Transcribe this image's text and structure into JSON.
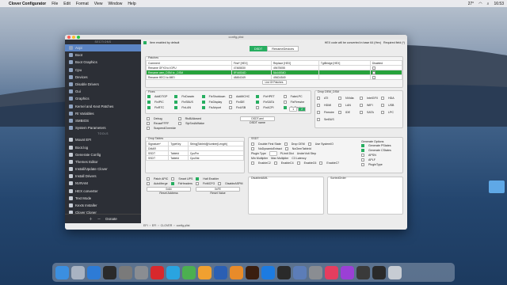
{
  "menubar": {
    "app": "Clover Configurator",
    "items": [
      "File",
      "Edit",
      "Format",
      "View",
      "Window",
      "Help"
    ],
    "status": "27°",
    "clock": "16:53"
  },
  "window": {
    "title": "config.plist",
    "item_enabled": "Item enabled by default",
    "hex_note": "HEX code will be converted in base 64 (Hex)",
    "required": "Required field (*)"
  },
  "sidebar": {
    "section_header": "SECTIONS",
    "tools_header": "TOOLS",
    "items": [
      "Acpi",
      "Boot",
      "Boot Graphics",
      "Cpu",
      "Devices",
      "Disable Drivers",
      "Gui",
      "Graphics",
      "Kernel and Kext Patches",
      "Rt Variables",
      "SMBIOS",
      "System Parameters"
    ],
    "tools": [
      "Mount EFI",
      "Boot.log",
      "Generate Config",
      "Themes Editor",
      "Install/Update Clover",
      "Install Drivers",
      "NVRAM",
      "HEX converter",
      "Text Mode",
      "Kexts Installer",
      "Clover Cloner"
    ],
    "donate": "Donate"
  },
  "tabs": [
    "DSDT",
    "RenameDevices"
  ],
  "patches": {
    "label": "Patches",
    "columns": [
      "Comment",
      "Find* [HEX]",
      "Replace [HEX]",
      "TgtBridge [HEX]",
      "Disabled"
    ],
    "rows": [
      [
        "Rename GFX0 to IGPU",
        "47465830",
        "49475055",
        "",
        ""
      ],
      [
        "Rename oem_DSM to _DSM",
        "5F44534D",
        "5A44534D",
        "",
        ""
      ],
      [
        "Rename HECI to IMEI",
        "48454349",
        "494D4549",
        "",
        ""
      ]
    ],
    "list_button": "List Of Patches"
  },
  "fixes": {
    "label": "Fixes",
    "items": [
      {
        "name": "AddDTGP",
        "on": true
      },
      {
        "name": "FixDarwin",
        "on": true
      },
      {
        "name": "FixShutdown",
        "on": true
      },
      {
        "name": "AddMCHC",
        "on": false
      },
      {
        "name": "FixHPET",
        "on": true
      },
      {
        "name": "FakeLPC",
        "on": false
      },
      {
        "name": "FixIPIC",
        "on": true
      },
      {
        "name": "FixSBUS",
        "on": true
      },
      {
        "name": "FixDisplay",
        "on": true
      },
      {
        "name": "FixIDE",
        "on": false
      },
      {
        "name": "FixSATA",
        "on": true
      },
      {
        "name": "FixFirewire",
        "on": false
      },
      {
        "name": "FixRTC",
        "on": true
      },
      {
        "name": "FixLAN",
        "on": true
      },
      {
        "name": "FixAirport",
        "on": true
      },
      {
        "name": "FixUSB",
        "on": false
      },
      {
        "name": "FixACPI",
        "on": false
      },
      {
        "name": "FixRegions",
        "on": true
      }
    ]
  },
  "drop_oem": {
    "label": "Drop OEM_DSM",
    "items": [
      "ATI",
      "NVidia",
      "IntelGFX",
      "HDA",
      "HDMI",
      "LAN",
      "WIFI",
      "USB",
      "Firewire",
      "IDE",
      "SATA",
      "LPC",
      "SmBUS"
    ]
  },
  "debug": [
    "Debug",
    "ReuseFFFF",
    "SuspendOverride"
  ],
  "debug_right": [
    "RtcBAllowed",
    "SlpSmiAtWake"
  ],
  "dsdt_name": {
    "value": "DSDT.aml",
    "label": "DSDT name"
  },
  "page_btns": [
    "1",
    "2"
  ],
  "drop_tables": {
    "label": "Drop Tables",
    "columns": [
      "Signature*",
      "TypeKey",
      "String[TableId]|Number[Length]"
    ],
    "rows": [
      [
        "DMAR",
        "",
        ""
      ],
      [
        "SSDT",
        "Tableld",
        "CpuPm"
      ],
      [
        "SSDT",
        "Tableld",
        "Cpu0Ist"
      ]
    ]
  },
  "ssdt": {
    "label": "SSDT",
    "checks": [
      "Double First State",
      "Drop OEM",
      "Use SystemIO",
      "NoDynamicExtract",
      "NoOemTableId"
    ],
    "plugin_type": "Plugin Type",
    "plimit": "PLimit Dict",
    "underfreq": "UnderVolt Step",
    "min_mult": "Min Multiplier",
    "max_mult": "Max Multiplier",
    "c3": "C3 Latency",
    "c_states": [
      "EnableC2",
      "EnableC4",
      "EnableC6",
      "EnableC7"
    ],
    "gen_label": "Generate Options",
    "generate": [
      "Generate PStates",
      "Generate CStates",
      "APSN",
      "APLF",
      "PluginType"
    ]
  },
  "patch_apic": [
    "Patch APIC",
    "Smart UPS",
    "Halt Enabler"
  ],
  "reset_row": [
    "AutoMerge",
    "FixHeaders",
    "FixMCFG",
    "DisableASPM"
  ],
  "reset": {
    "address": "0x64",
    "value": "0xFE",
    "address_label": "Reset Address",
    "value_label": "Reset Value"
  },
  "disabled_aml": "DisabledAML",
  "sorted_order": "SortedOrder",
  "path": [
    "EFI",
    "EFI",
    "CLOVER",
    "config.plist"
  ],
  "dock": {
    "apps": [
      "finder",
      "launchpad",
      "safari",
      "terminal",
      "utility",
      "system-prefs",
      "opera",
      "telegram",
      "maps",
      "photos",
      "word",
      "books",
      "illustrator",
      "xcode-icon",
      "finalcut",
      "clover-configurator",
      "settings",
      "media",
      "podcasts",
      "activity",
      "terminal",
      "trash"
    ]
  },
  "accent": "#27ae60",
  "select_blue": "#5b84c4"
}
